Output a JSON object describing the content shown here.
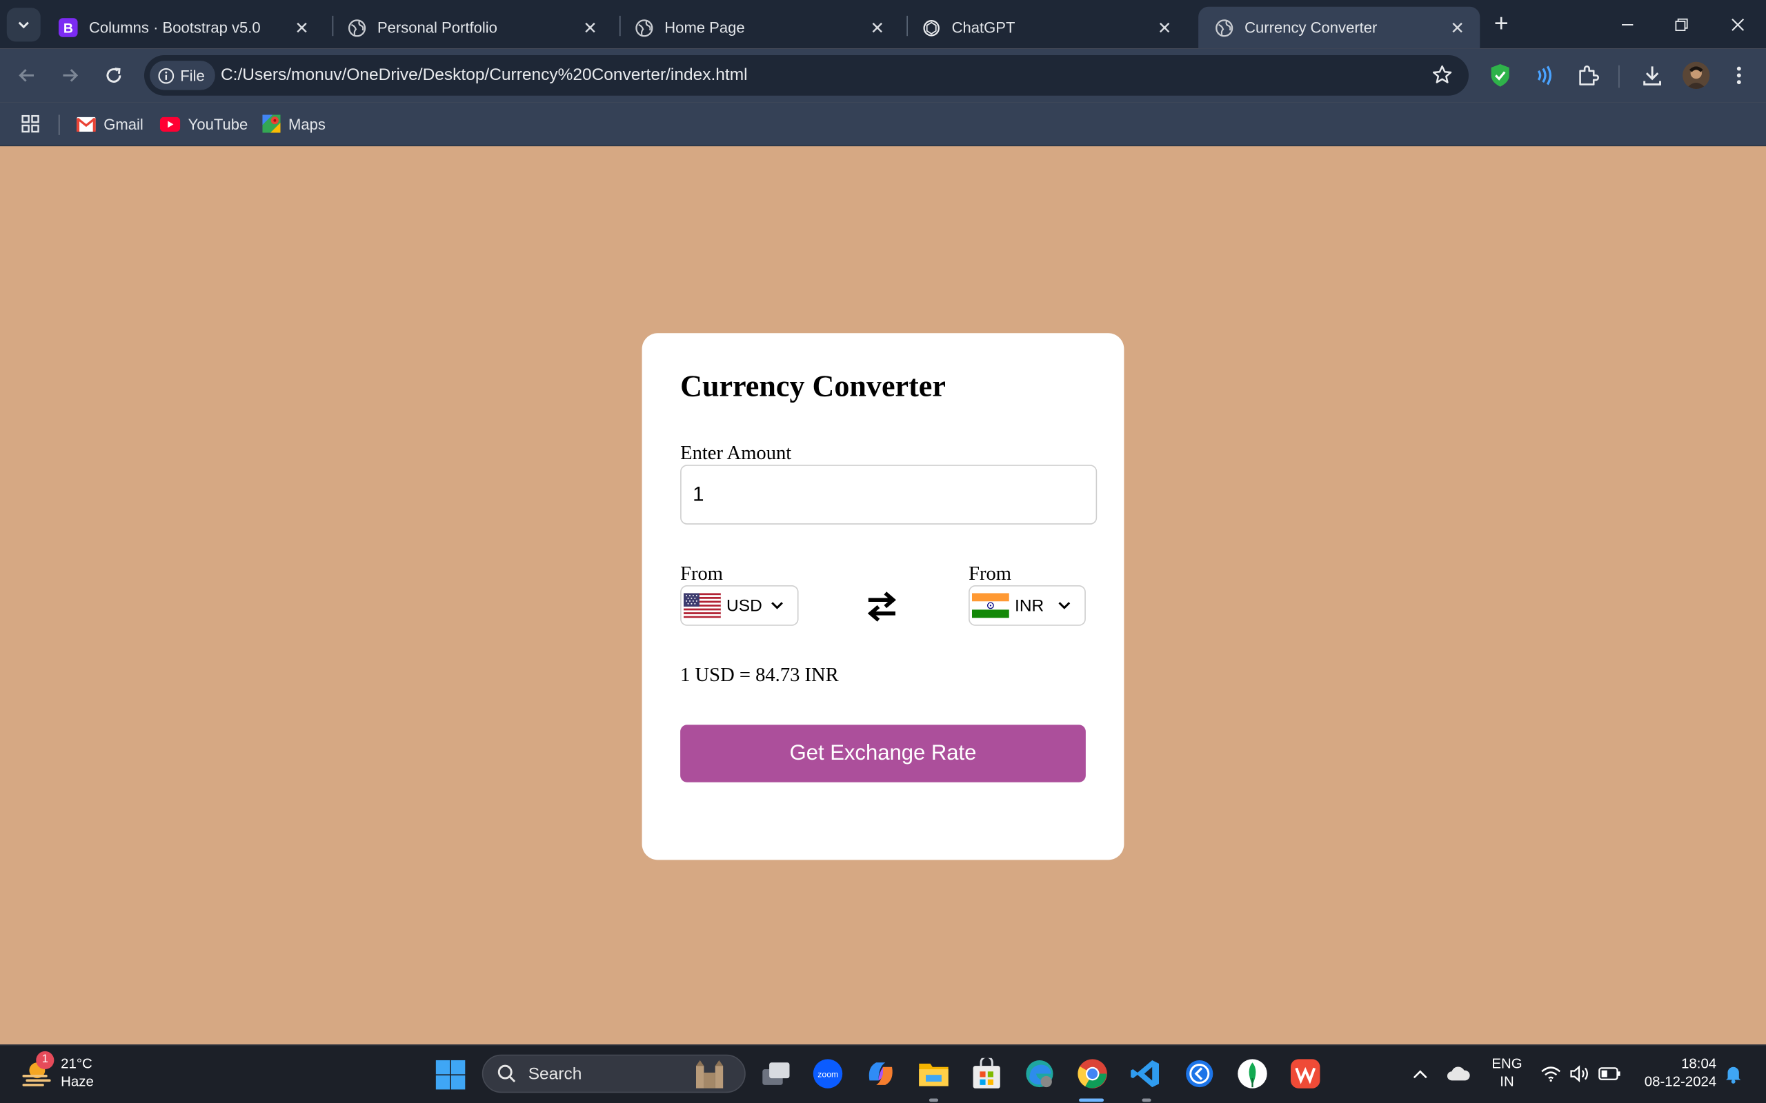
{
  "browser": {
    "tabs": [
      {
        "title": "Columns · Bootstrap v5.0",
        "favicon": "bootstrap-icon"
      },
      {
        "title": "Personal Portfolio",
        "favicon": "globe-icon"
      },
      {
        "title": "Home Page",
        "favicon": "globe-icon"
      },
      {
        "title": "ChatGPT",
        "favicon": "chatgpt-icon"
      },
      {
        "title": "Currency Converter",
        "favicon": "globe-icon",
        "active": true
      }
    ],
    "address": {
      "scheme_chip": "File",
      "url": "C:/Users/monuv/OneDrive/Desktop/Currency%20Converter/index.html"
    },
    "bookmarks": [
      {
        "label": "Gmail",
        "icon": "gmail-icon"
      },
      {
        "label": "YouTube",
        "icon": "youtube-icon"
      },
      {
        "label": "Maps",
        "icon": "maps-icon"
      }
    ]
  },
  "converter": {
    "title": "Currency Converter",
    "amount_label": "Enter Amount",
    "amount_value": "1",
    "from_label": "From",
    "to_label": "From",
    "from_currency": "USD",
    "to_currency": "INR",
    "rate_text": "1 USD = 84.73 INR",
    "button_label": "Get Exchange Rate",
    "colors": {
      "page_bg": "#d6a883",
      "button": "#ac4f9b"
    }
  },
  "taskbar": {
    "weather": {
      "temp": "21°C",
      "condition": "Haze",
      "badge": "1"
    },
    "search_label": "Search",
    "language": {
      "line1": "ENG",
      "line2": "IN"
    },
    "clock": {
      "time": "18:04",
      "date": "08-12-2024"
    }
  }
}
